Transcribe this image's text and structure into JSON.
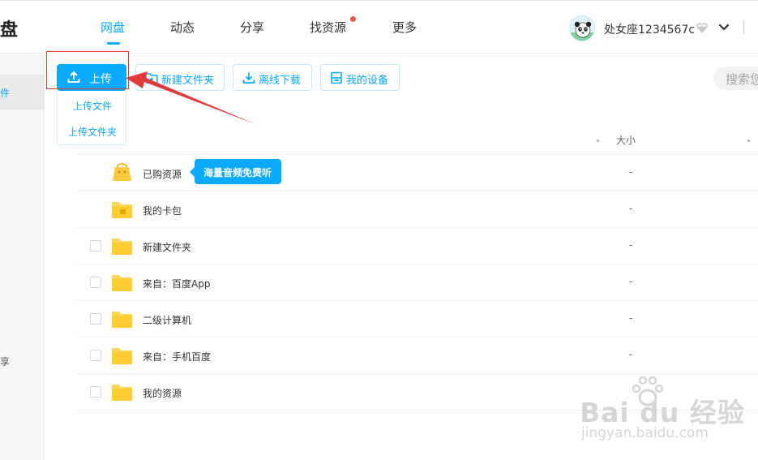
{
  "header": {
    "brand": "盘",
    "nav": [
      {
        "label": "网盘",
        "active": true
      },
      {
        "label": "动态"
      },
      {
        "label": "分享"
      },
      {
        "label": "找资源",
        "has_dot": true
      },
      {
        "label": "更多"
      }
    ],
    "username": "处女座1234567c"
  },
  "sidebar": {
    "items": [
      {
        "label": "件"
      },
      {
        "label": "享"
      }
    ]
  },
  "toolbar": {
    "upload_label": "上传",
    "new_folder_label": "新建文件夹",
    "offline_download_label": "离线下载",
    "my_devices_label": "我的设备",
    "search_placeholder": "搜索您"
  },
  "upload_menu": {
    "options": [
      "上传文件",
      "上传文件夹"
    ]
  },
  "table": {
    "size_header": "大小",
    "rows": [
      {
        "name": "已购资源",
        "size": "-",
        "icon": "purchased-resources-icon",
        "checkbox": false
      },
      {
        "name": "我的卡包",
        "size": "-",
        "icon": "card-wallet-icon",
        "checkbox": false
      },
      {
        "name": "新建文件夹",
        "size": "-",
        "icon": "folder-icon",
        "checkbox": true
      },
      {
        "name": "来自：百度App",
        "size": "-",
        "icon": "folder-icon",
        "checkbox": true
      },
      {
        "name": "二级计算机",
        "size": "-",
        "icon": "folder-icon",
        "checkbox": true
      },
      {
        "name": "来自：手机百度",
        "size": "-",
        "icon": "folder-icon",
        "checkbox": true
      },
      {
        "name": "我的资源",
        "size": "",
        "icon": "folder-icon",
        "checkbox": true
      }
    ]
  },
  "tooltip": {
    "text": "海量音频免费听"
  },
  "watermark": {
    "main": "Bai du 经验",
    "sub": "jingyan.baidu.com"
  },
  "colors": {
    "accent": "#09aaff",
    "folder": "#ffd658",
    "annotation": "#e23a3a"
  }
}
